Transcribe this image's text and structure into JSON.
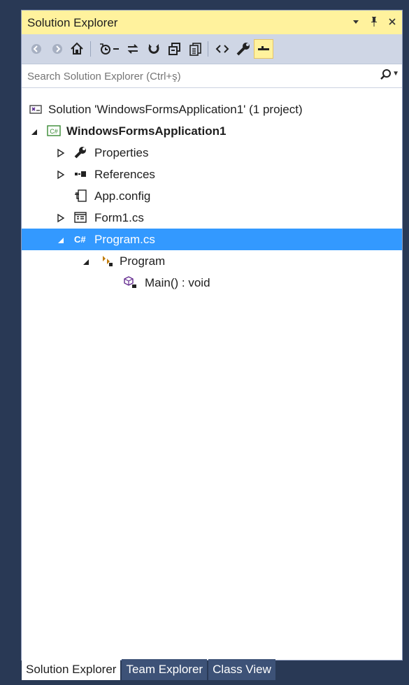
{
  "panel": {
    "title": "Solution Explorer",
    "title_icons": [
      "dropdown-icon",
      "pin-icon",
      "close-icon"
    ]
  },
  "toolbar": {
    "buttons": [
      "back-icon",
      "forward-icon",
      "home-icon",
      "history-icon",
      "sync-icon",
      "refresh-icon",
      "collapse-all-icon",
      "show-all-files-icon",
      "view-code-icon",
      "properties-icon",
      "preview-icon"
    ]
  },
  "search": {
    "placeholder": "Search Solution Explorer (Ctrl+ş)"
  },
  "tree": {
    "solution": "Solution 'WindowsFormsApplication1' (1 project)",
    "project": "WindowsFormsApplication1",
    "properties": "Properties",
    "references": "References",
    "appconfig": "App.config",
    "form1": "Form1.cs",
    "program_cs": "Program.cs",
    "program_class": "Program",
    "main_method": "Main() : void"
  },
  "tabs": [
    "Solution Explorer",
    "Team Explorer",
    "Class View"
  ],
  "colors": {
    "selection": "#3399ff",
    "title_bar": "#fff29d",
    "frame": "#293955",
    "tab_inactive": "#3d5277"
  }
}
